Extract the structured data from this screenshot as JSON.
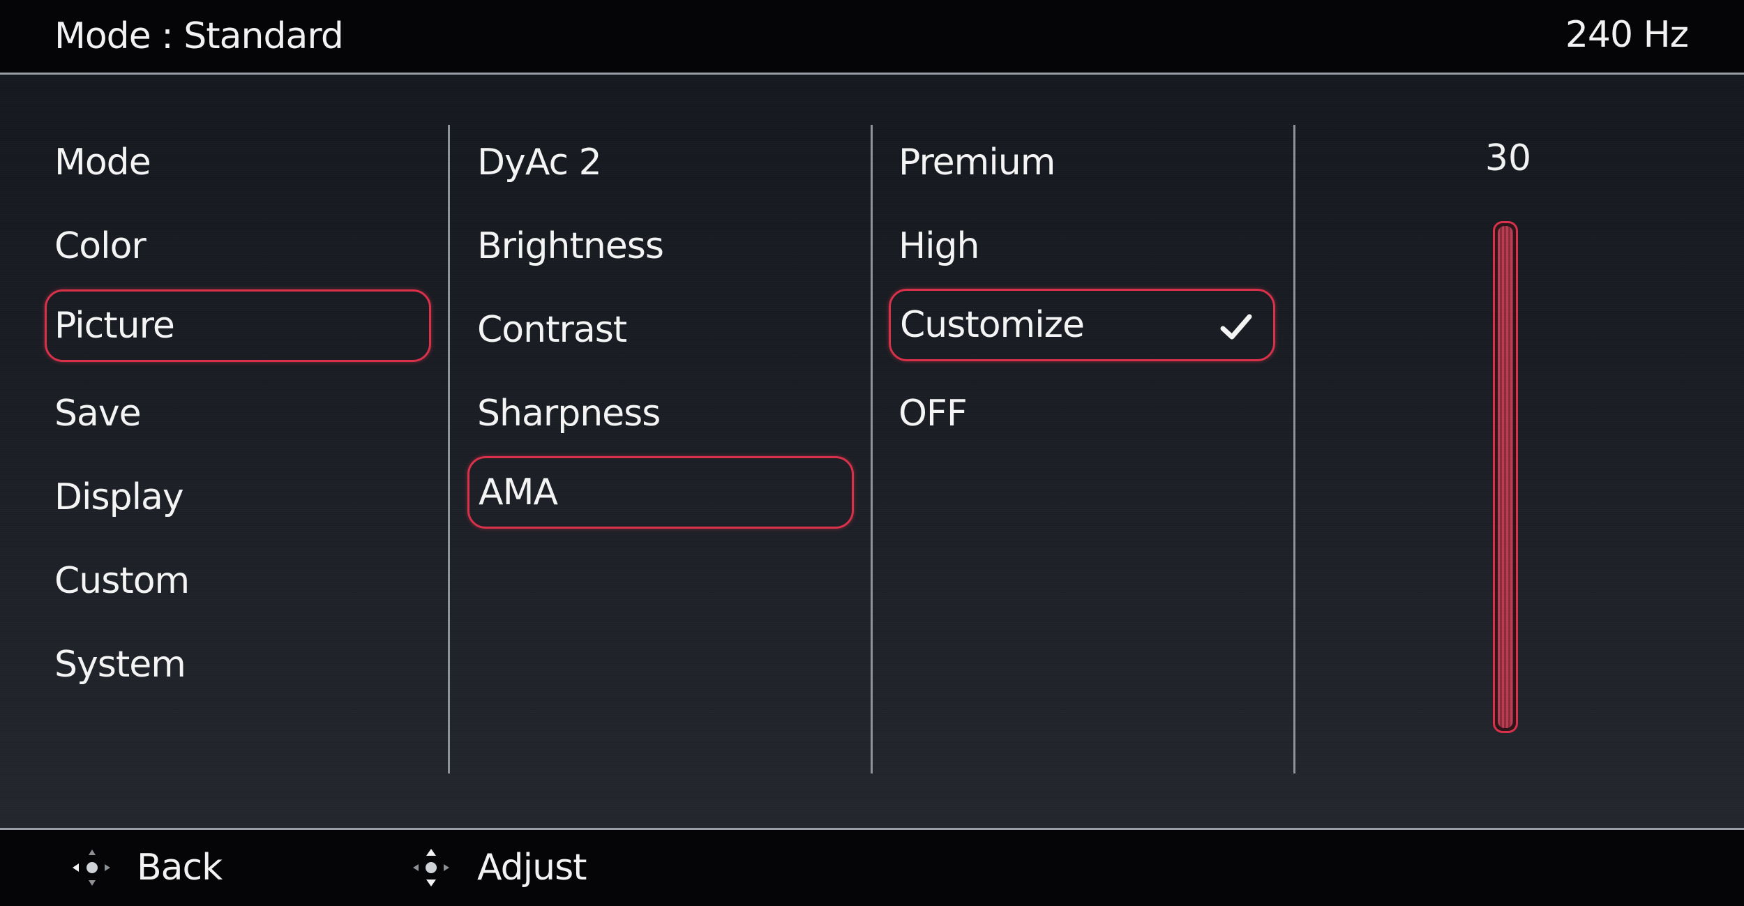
{
  "header": {
    "mode_title": "Mode : Standard",
    "refresh_rate": "240 Hz"
  },
  "menu": {
    "items": [
      {
        "label": "Mode"
      },
      {
        "label": "Color"
      },
      {
        "label": "Picture",
        "selected": true
      },
      {
        "label": "Save"
      },
      {
        "label": "Display"
      },
      {
        "label": "Custom"
      },
      {
        "label": "System"
      }
    ]
  },
  "submenu": {
    "items": [
      {
        "label": "DyAc 2"
      },
      {
        "label": "Brightness"
      },
      {
        "label": "Contrast"
      },
      {
        "label": "Sharpness"
      },
      {
        "label": "AMA",
        "selected": true
      }
    ]
  },
  "options": {
    "items": [
      {
        "label": "Premium"
      },
      {
        "label": "High"
      },
      {
        "label": "Customize",
        "selected": true,
        "checked": true
      },
      {
        "label": "OFF"
      }
    ],
    "check_icon": "checkmark-icon"
  },
  "value_panel": {
    "value": "30",
    "level_fraction": 1.0,
    "accent_color": "#d9304a"
  },
  "footer": {
    "back_label": "Back",
    "back_icon": "joystick-left-icon",
    "adjust_label": "Adjust",
    "adjust_icon": "joystick-updown-icon"
  }
}
